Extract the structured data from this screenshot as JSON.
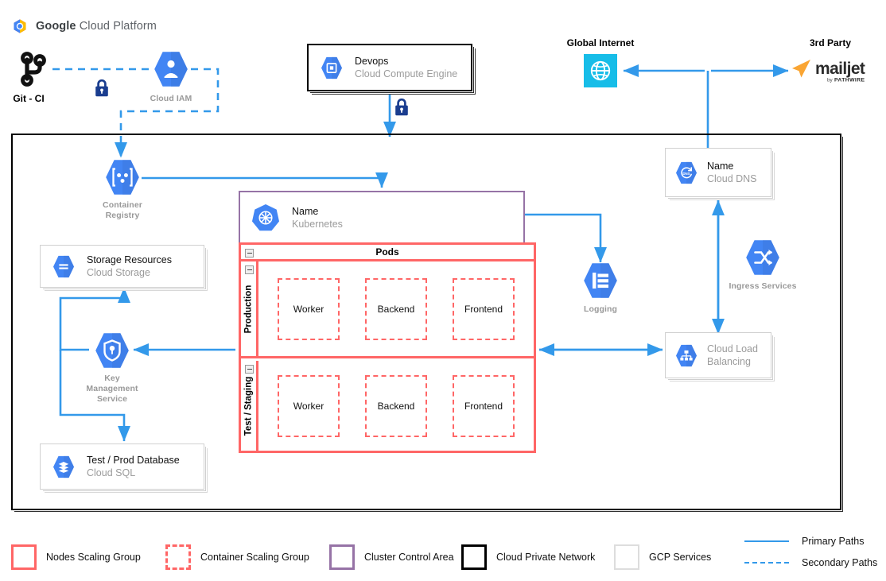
{
  "brand": {
    "bold": "Google",
    "light": "Cloud Platform",
    "logo_icon": "google-cloud-logo"
  },
  "external": {
    "git": {
      "label": "Git - CI",
      "icon": "git-branch-icon"
    },
    "iam": {
      "label": "Cloud IAM",
      "icon": "cloud-iam-icon"
    },
    "devops": {
      "title": "Devops",
      "subtitle": "Cloud Compute Engine",
      "icon": "compute-engine-icon"
    },
    "internet": {
      "label": "Global Internet",
      "icon": "globe-icon"
    },
    "thirdparty": {
      "label": "3rd Party",
      "logo": "mailjet-logo",
      "wordmark": "mailjet",
      "tagline": "by PATHWIRE"
    },
    "lock_icon": "padlock-icon"
  },
  "network": {
    "name": "Cloud Private Network"
  },
  "services": {
    "container_registry": {
      "label": "Container\nRegistry",
      "line1": "Container",
      "line2": "Registry",
      "icon": "container-registry-icon"
    },
    "storage": {
      "title": "Storage Resources",
      "subtitle": "Cloud Storage",
      "icon": "cloud-storage-icon"
    },
    "kms": {
      "line1": "Key",
      "line2": "Management",
      "line3": "Service",
      "icon": "key-management-icon"
    },
    "database": {
      "title": "Test / Prod Database",
      "subtitle": "Cloud SQL",
      "icon": "cloud-sql-icon"
    },
    "dns": {
      "title": "Name",
      "subtitle": "Cloud DNS",
      "icon": "cloud-dns-icon"
    },
    "logging": {
      "label": "Logging",
      "icon": "logging-icon"
    },
    "ingress": {
      "label": "Ingress Services",
      "icon": "ingress-services-icon"
    },
    "load_balancing": {
      "title": "Cloud Load",
      "subtitle": "Balancing",
      "icon": "cloud-load-balancing-icon"
    }
  },
  "cluster": {
    "title": "Name",
    "subtitle": "Kubernetes",
    "icon": "kubernetes-icon",
    "pods_header": "Pods",
    "lanes": [
      {
        "name": "Production",
        "pods": [
          "Worker",
          "Backend",
          "Frontend"
        ]
      },
      {
        "name": "Test / Staging",
        "pods": [
          "Worker",
          "Backend",
          "Frontend"
        ]
      }
    ]
  },
  "legend": {
    "items": [
      {
        "label": "Nodes Scaling Group",
        "style": "red"
      },
      {
        "label": "Container Scaling Group",
        "style": "reddash"
      },
      {
        "label": "Cluster Control Area",
        "style": "purple"
      },
      {
        "label": "Cloud Private Network",
        "style": "black"
      },
      {
        "label": "GCP Services",
        "style": "gray"
      }
    ],
    "paths": [
      {
        "label": "Primary Paths",
        "style": "solid"
      },
      {
        "label": "Secondary Paths",
        "style": "dash"
      }
    ]
  },
  "colors": {
    "primary_path": "#3399ea",
    "nodes_scaling": "#ff6666",
    "cluster_control": "#9673a6",
    "gcp_blue": "#4285f4",
    "internet_cyan": "#17bde8",
    "lock_navy": "#1a3d8f",
    "mailjet_orange": "#faa533"
  }
}
